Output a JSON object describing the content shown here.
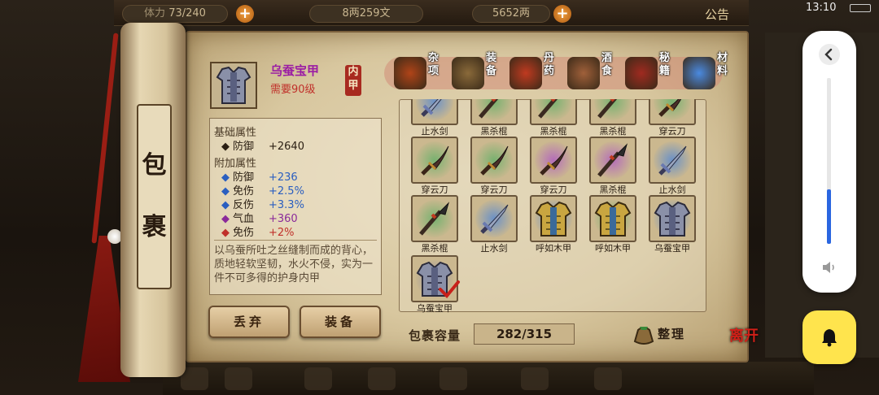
{
  "topbar": {
    "stamina": "73/240",
    "stamina_prefix": "体力",
    "money": "8两259文",
    "gold": "5652两",
    "notice": "公告"
  },
  "status": {
    "clock": "13:10"
  },
  "bag": {
    "title_1": "包",
    "title_2": "裹"
  },
  "item": {
    "name": "乌蚕宝甲",
    "requirement": "需要90级",
    "slot_tag": "内甲",
    "base_header": "基础属性",
    "base_attrs": [
      {
        "name": "防御",
        "value": "+2640"
      }
    ],
    "extra_header": "附加属性",
    "extra_attrs": [
      {
        "name": "防御",
        "value": "+236",
        "color": "#2a5ec0"
      },
      {
        "name": "免伤",
        "value": "+2.5%",
        "color": "#2a5ec0"
      },
      {
        "name": "反伤",
        "value": "+3.3%",
        "color": "#2a5ec0"
      },
      {
        "name": "气血",
        "value": "+360",
        "color": "#8a2a9a"
      },
      {
        "name": "免伤",
        "value": "+2%",
        "color": "#c0302a"
      }
    ],
    "description": "以乌蚕所吐之丝缝制而成的背心，质地轻软坚韧，水火不侵，实为一件不可多得的护身内甲"
  },
  "buttons": {
    "discard": "丢弃",
    "equip": "装备"
  },
  "tabs": [
    {
      "label": "杂项",
      "icon": "jar-icon",
      "color": "#b04418"
    },
    {
      "label": "装备",
      "icon": "weapons-icon",
      "color": "#8a6a3a"
    },
    {
      "label": "丹药",
      "icon": "pills-icon",
      "color": "#c03a20"
    },
    {
      "label": "酒食",
      "icon": "food-icon",
      "color": "#a0603a"
    },
    {
      "label": "秘籍",
      "icon": "books-icon",
      "color": "#a02a20"
    },
    {
      "label": "材料",
      "icon": "crystal-icon",
      "color": "#4a8ae0"
    }
  ],
  "grid": {
    "rows": [
      [
        {
          "label": "止水剑",
          "type": "sword",
          "aura": "#5a8ad0"
        },
        {
          "label": "黑杀棍",
          "type": "spear",
          "aura": "#6ab06a"
        },
        {
          "label": "黑杀棍",
          "type": "spear",
          "aura": "#6ab06a"
        },
        {
          "label": "黑杀棍",
          "type": "spear",
          "aura": "#6ab06a"
        },
        {
          "label": "穿云刀",
          "type": "blade",
          "aura": "#6ab06a"
        }
      ],
      [
        {
          "label": "穿云刀",
          "type": "blade",
          "aura": "#6ab06a"
        },
        {
          "label": "穿云刀",
          "type": "blade",
          "aura": "#6ab06a"
        },
        {
          "label": "穿云刀",
          "type": "blade",
          "aura": "#b060c0"
        },
        {
          "label": "黑杀棍",
          "type": "spear",
          "aura": "#b060c0"
        },
        {
          "label": "止水剑",
          "type": "sword",
          "aura": "#5a8ad0"
        }
      ],
      [
        {
          "label": "黑杀棍",
          "type": "spear",
          "aura": "#6ab06a"
        },
        {
          "label": "止水剑",
          "type": "sword",
          "aura": "#5a8ad0"
        },
        {
          "label": "呼如木甲",
          "type": "armor-gold",
          "aura": "#5a8ad0"
        },
        {
          "label": "呼如木甲",
          "type": "armor-gold",
          "aura": "#6ab06a"
        },
        {
          "label": "乌蚕宝甲",
          "type": "armor-silver",
          "aura": "#5a8ad0"
        }
      ],
      [
        {
          "label": "乌蚕宝甲",
          "type": "armor-silver",
          "aura": "#8a8aa0",
          "selected": true
        }
      ]
    ]
  },
  "capacity": {
    "label": "包裹容量",
    "value": "282/315"
  },
  "tidy": {
    "label": "整理"
  },
  "leave": {
    "label": "离开"
  },
  "volume": {
    "level": 0.33
  }
}
